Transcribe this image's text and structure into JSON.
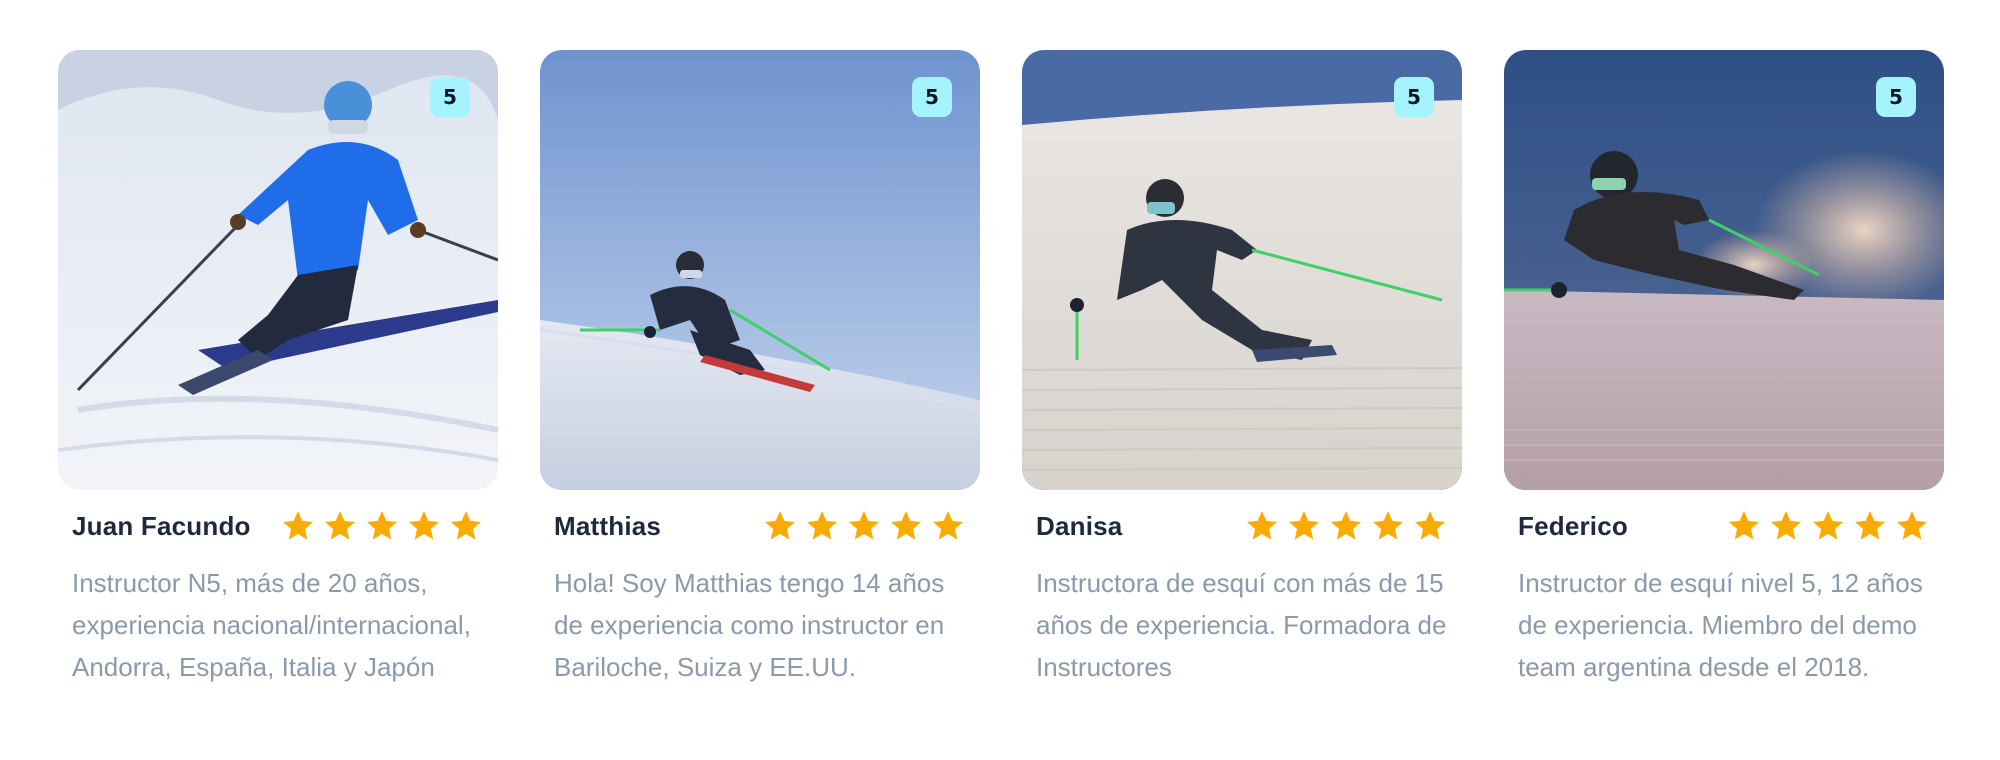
{
  "instructors": [
    {
      "name": "Juan Facundo",
      "badge": "5",
      "rating": 5,
      "bio": "Instructor N5, más de 20 años, experiencia nacional/internacional, Andorra, España, Italia y Japón",
      "photo_icon": "skier-blue-jacket-photo"
    },
    {
      "name": "Matthias",
      "badge": "5",
      "rating": 5,
      "bio": "Hola! Soy Matthias tengo 14 años de experiencia como instructor en Bariloche, Suiza y EE.UU.",
      "photo_icon": "skier-dark-suit-blue-sky-photo"
    },
    {
      "name": "Danisa",
      "badge": "5",
      "rating": 5,
      "bio": "Instructora de esquí con más de 15 años de experiencia. Formadora de Instructores",
      "photo_icon": "skier-dark-suit-slope-photo"
    },
    {
      "name": "Federico",
      "badge": "5",
      "rating": 5,
      "bio": "Instructor de esquí nivel 5, 12 años de experiencia. Miembro del demo team argentina desde el 2018.",
      "photo_icon": "skier-sunset-spray-photo"
    }
  ],
  "colors": {
    "star": "#fbab00",
    "badge_bg": "#a5f3fc",
    "name": "#1e293b",
    "bio": "#8b99ab"
  }
}
